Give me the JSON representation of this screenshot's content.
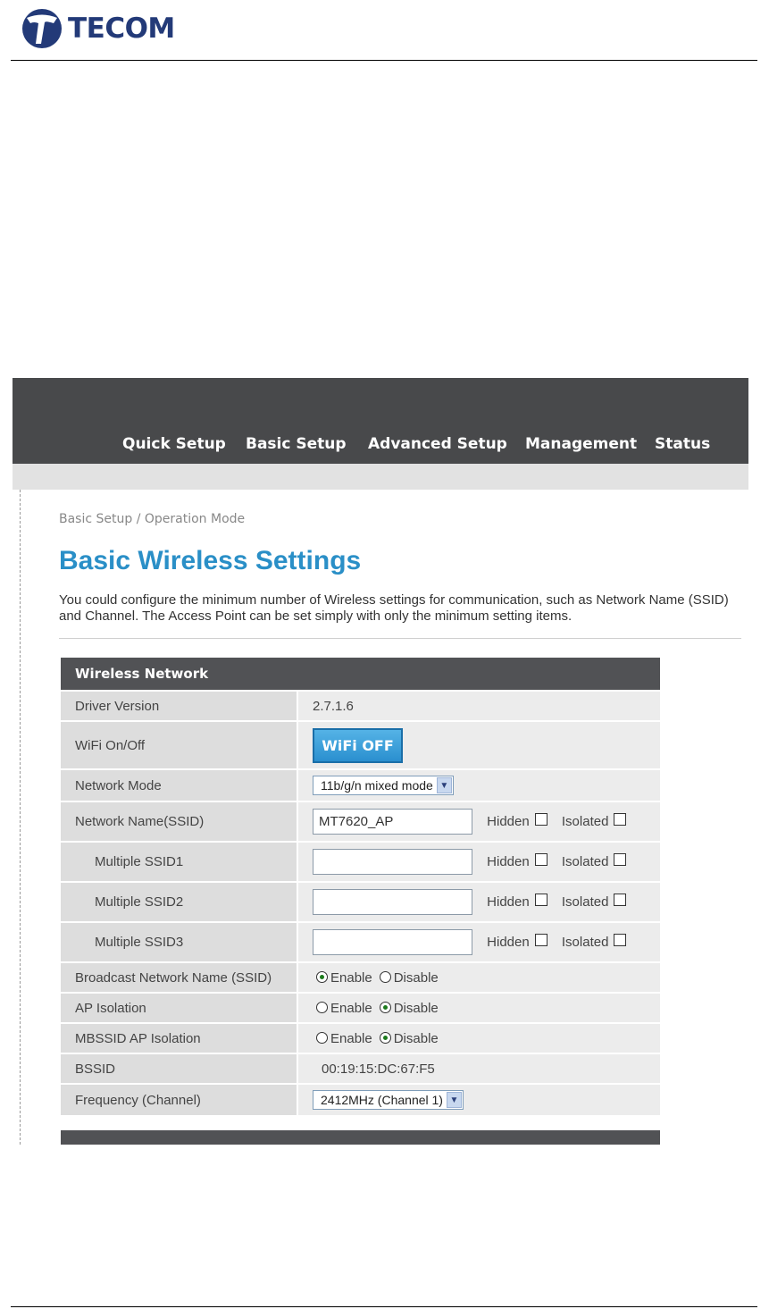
{
  "doc": {
    "brand": "TECOM"
  },
  "nav": {
    "items": [
      "Quick Setup",
      "Basic Setup",
      "Advanced Setup",
      "Management",
      "Status"
    ]
  },
  "breadcrumb": "Basic Setup / Operation Mode",
  "page_title": "Basic Wireless Settings",
  "intro": "You could configure the minimum number of Wireless settings for communication, such as Network Name (SSID) and Channel. The Access Point can be set simply with only the minimum setting items.",
  "table": {
    "header": "Wireless Network",
    "driver_version": {
      "label": "Driver Version",
      "value": "2.7.1.6"
    },
    "wifi": {
      "label": "WiFi On/Off",
      "button": "WiFi OFF"
    },
    "network_mode": {
      "label": "Network Mode",
      "selected": "11b/g/n mixed mode"
    },
    "ssid": {
      "label": "Network Name(SSID)",
      "value": "MT7620_AP"
    },
    "mssid1": {
      "label": "Multiple SSID1",
      "value": ""
    },
    "mssid2": {
      "label": "Multiple SSID2",
      "value": ""
    },
    "mssid3": {
      "label": "Multiple SSID3",
      "value": ""
    },
    "hidden_label": "Hidden",
    "isolated_label": "Isolated",
    "broadcast": {
      "label": "Broadcast Network Name (SSID)",
      "selected": "Enable"
    },
    "ap_isolation": {
      "label": "AP Isolation",
      "selected": "Disable"
    },
    "mbssid_isolation": {
      "label": "MBSSID AP Isolation",
      "selected": "Disable"
    },
    "enable_label": "Enable",
    "disable_label": "Disable",
    "bssid": {
      "label": "BSSID",
      "value": "00:19:15:DC:67:F5"
    },
    "frequency": {
      "label": "Frequency (Channel)",
      "selected": "2412MHz (Channel 1)"
    }
  },
  "colors": {
    "nav_bg": "#48494b",
    "title_blue": "#2a8fc7",
    "button_blue": "#2a8fcf",
    "table_header": "#515255"
  }
}
